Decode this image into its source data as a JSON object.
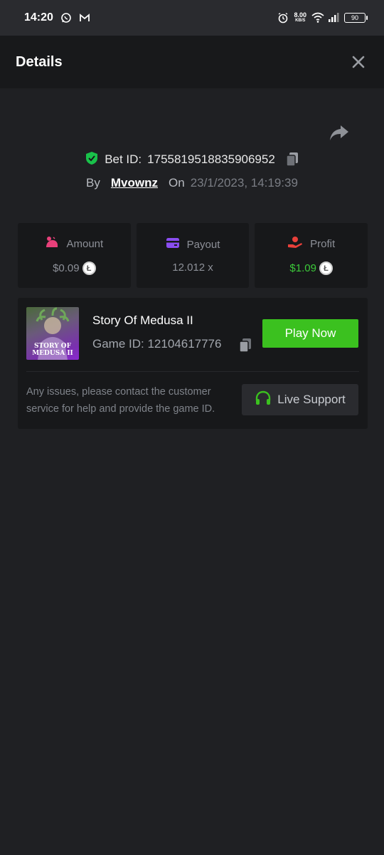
{
  "status_bar": {
    "time": "14:20",
    "net_speed": "8.00",
    "net_unit": "KB/S",
    "battery": "90"
  },
  "header": {
    "title": "Details"
  },
  "bet": {
    "label": "Bet ID:",
    "id": "1755819518835906952",
    "by_label": "By",
    "user": "Mvownz",
    "on_label": "On",
    "date": "23/1/2023, 14:19:39"
  },
  "stats": {
    "amount_label": "Amount",
    "amount_value": "$0.09",
    "payout_label": "Payout",
    "payout_value": "12.012 x",
    "profit_label": "Profit",
    "profit_value": "$1.09"
  },
  "game": {
    "thumb_line1": "STORY OF",
    "thumb_line2": "MEDUSA II",
    "name": "Story Of Medusa II",
    "id_text": "Game ID: 12104617776",
    "play_label": "Play Now",
    "help_text": "Any issues, please contact the customer service for help and provide the game ID.",
    "support_label": "Live Support"
  },
  "colors": {
    "accent_green": "#3bc11f",
    "profit_green": "#3cc93a",
    "shield_green": "#19c14a",
    "amount_pink": "#e8407a",
    "payout_purple": "#8a4df0",
    "profit_red": "#e8403a"
  },
  "icons": {
    "whatsapp": "whatsapp-icon",
    "gmail": "gmail-icon",
    "alarm": "alarm-icon",
    "wifi": "wifi-icon",
    "signal": "signal-icon",
    "close": "close-icon",
    "share": "share-icon",
    "shield": "shield-check-icon",
    "copy": "copy-icon",
    "amount": "amount-icon",
    "payout": "card-icon",
    "profit": "profit-hand-icon",
    "coin": "litecoin-icon",
    "headset": "headset-icon"
  }
}
